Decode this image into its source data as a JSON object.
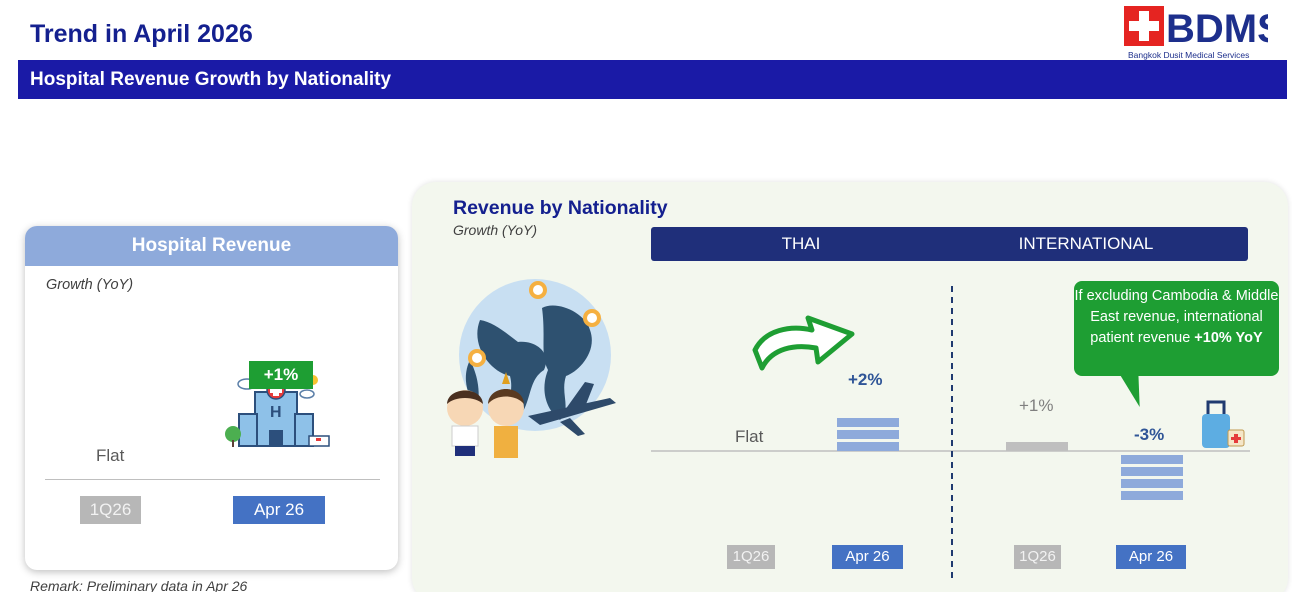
{
  "header": {
    "title": "Trend in April 2026",
    "logo_text": "BDMS",
    "logo_subtext": "Bangkok Dusit Medical Services",
    "banner": "Hospital Revenue Growth by Nationality"
  },
  "colors": {
    "navy": "#14208f",
    "banner": "#1a1aa6",
    "green": "#1e9e33",
    "bar_blue": "#8eaadb",
    "bar_grey": "#bfbfbf",
    "tag_blue": "#4472c4",
    "tag_grey": "#b7b7b7"
  },
  "left_card": {
    "title": "Hospital Revenue",
    "subtitle": "Growth (YoY)",
    "icon": "hospital-icon"
  },
  "right_panel": {
    "title": "Revenue by Nationality",
    "subtitle": "Growth (YoY)",
    "columns": [
      "THAI",
      "INTERNATIONAL"
    ],
    "callout_text": "If excluding Cambodia & Middle East revenue, international patient revenue",
    "callout_highlight": "+10% YoY",
    "icons": [
      "globe-icon",
      "green-arrow-icon",
      "airplane-icon",
      "luggage-icon"
    ]
  },
  "remark": "Remark: Preliminary data in Apr 26",
  "chart_data": [
    {
      "type": "bar",
      "title": "Hospital Revenue",
      "ylabel": "Growth (YoY)",
      "categories": [
        "1Q26",
        "Apr 26"
      ],
      "values": [
        0,
        1
      ],
      "labels": [
        "Flat",
        "+1%"
      ]
    },
    {
      "type": "bar",
      "title": "THAI",
      "ylabel": "Growth (YoY)",
      "categories": [
        "1Q26",
        "Apr 26"
      ],
      "values": [
        0,
        2
      ],
      "labels": [
        "Flat",
        "+2%"
      ]
    },
    {
      "type": "bar",
      "title": "INTERNATIONAL",
      "ylabel": "Growth (YoY)",
      "categories": [
        "1Q26",
        "Apr 26"
      ],
      "values": [
        1,
        -3
      ],
      "labels": [
        "+1%",
        "-3%"
      ]
    }
  ]
}
